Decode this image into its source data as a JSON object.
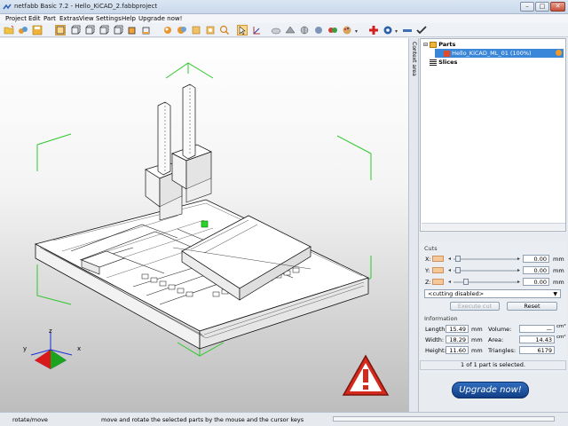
{
  "window": {
    "title": "netfabb Basic 7.2 - Hello_KiCAD_2.fabbproject"
  },
  "menu": [
    "Project",
    "Edit",
    "Part",
    "Extras",
    "View",
    "Settings",
    "Help",
    "Upgrade now!"
  ],
  "sidebar_tab": "Context area",
  "tree": {
    "parts_label": "Parts",
    "part_name": "Hello_KiCAD_ML_01 (100%)",
    "slices_label": "Slices"
  },
  "cuts": {
    "title": "Cuts",
    "axes": [
      {
        "label": "X:",
        "value": "0.00",
        "unit": "mm"
      },
      {
        "label": "Y:",
        "value": "0.00",
        "unit": "mm"
      },
      {
        "label": "Z:",
        "value": "0.00",
        "unit": "mm"
      }
    ],
    "mode": "<cutting disabled>",
    "execute_label": "Execute cut",
    "reset_label": "Reset"
  },
  "information": {
    "title": "Information",
    "length_label": "Length:",
    "length": "15.49",
    "length_unit": "mm",
    "width_label": "Width:",
    "width": "18.29",
    "width_unit": "mm",
    "height_label": "Height:",
    "height": "11.60",
    "height_unit": "mm",
    "volume_label": "Volume:",
    "volume": "—",
    "volume_unit": "cm³",
    "area_label": "Area:",
    "area": "14.43",
    "area_unit": "cm²",
    "triangles_label": "Triangles:",
    "triangles": "6179"
  },
  "selection_status": "1 of 1 part is selected.",
  "upgrade_label": "Upgrade now!",
  "status": {
    "mode": "rotate/move",
    "hint": "move and rotate the selected parts by the mouse and the cursor keys"
  },
  "axes_gizmo": {
    "x": "x",
    "y": "y",
    "z": "z"
  },
  "colors": {
    "accent": "#3a86d8",
    "upgrade": "#1b4f9c",
    "warning": "#d42a1e"
  }
}
